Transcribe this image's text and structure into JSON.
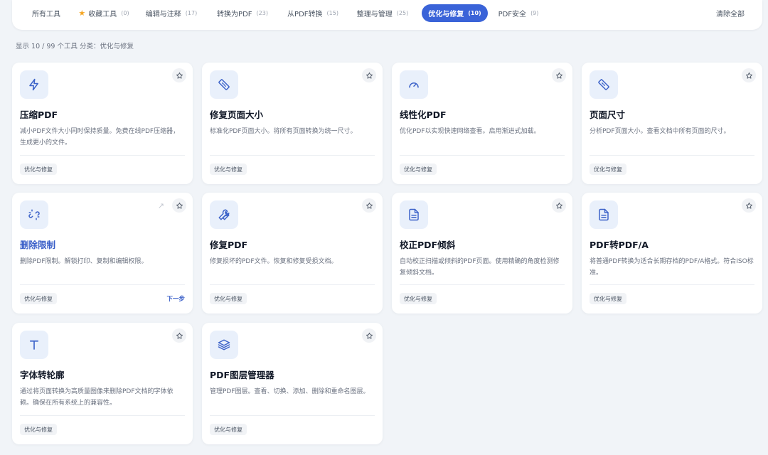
{
  "tabs": [
    {
      "label": "所有工具",
      "count": ""
    },
    {
      "label": "收藏工具",
      "count": "(0)",
      "icon": "star-icon"
    },
    {
      "label": "编辑与注释",
      "count": "(17)"
    },
    {
      "label": "转换为PDF",
      "count": "(23)"
    },
    {
      "label": "从PDF转换",
      "count": "(15)"
    },
    {
      "label": "整理与管理",
      "count": "(25)"
    },
    {
      "label": "优化与修复",
      "count": "(10)",
      "active": true
    },
    {
      "label": "PDF安全",
      "count": "(9)"
    }
  ],
  "clear_all": "清除全部",
  "status_text": "显示 10 / 99 个工具 分类：优化与修复",
  "colors": {
    "accent": "#3a63d8",
    "favorite": "#f5a623",
    "icon_bg": "#e9f0fb"
  },
  "cards": [
    {
      "title": "压缩PDF",
      "desc": "减小PDF文件大小同时保持质量。免费在线PDF压缩器，生成更小的文件。",
      "tag": "优化与修复",
      "icon": "lightning-icon"
    },
    {
      "title": "修复页面大小",
      "desc": "标准化PDF页面大小。将所有页面转换为统一尺寸。",
      "tag": "优化与修复",
      "icon": "ruler-icon"
    },
    {
      "title": "线性化PDF",
      "desc": "优化PDF以实现快速网络查看。启用渐进式加载。",
      "tag": "优化与修复",
      "icon": "gauge-icon"
    },
    {
      "title": "页面尺寸",
      "desc": "分析PDF页面大小。查看文档中所有页面的尺寸。",
      "tag": "优化与修复",
      "icon": "ruler-icon"
    },
    {
      "title": "删除限制",
      "desc": "删除PDF限制。解锁打印、复制和编辑权限。",
      "tag": "优化与修复",
      "icon": "unlink-icon",
      "next": "下一步",
      "arrow": "↗"
    },
    {
      "title": "修复PDF",
      "desc": "修复损坏的PDF文件。恢复和修复受损文档。",
      "tag": "优化与修复",
      "icon": "wrench-icon"
    },
    {
      "title": "校正PDF倾斜",
      "desc": "自动校正扫描或倾斜的PDF页面。使用精确的角度检测修复倾斜文档。",
      "tag": "优化与修复",
      "icon": "document-icon"
    },
    {
      "title": "PDF转PDF/A",
      "desc": "将普通PDF转换为适合长期存档的PDF/A格式。符合ISO标准。",
      "tag": "优化与修复",
      "icon": "document-icon"
    },
    {
      "title": "字体转轮廓",
      "desc": "通过将页面转换为高质量图像来删除PDF文档的字体依赖。确保在所有系统上的兼容性。",
      "tag": "优化与修复",
      "icon": "type-icon"
    },
    {
      "title": "PDF图层管理器",
      "desc": "管理PDF图层。查看、切换、添加、删除和重命名图层。",
      "tag": "优化与修复",
      "icon": "layers-icon"
    }
  ]
}
